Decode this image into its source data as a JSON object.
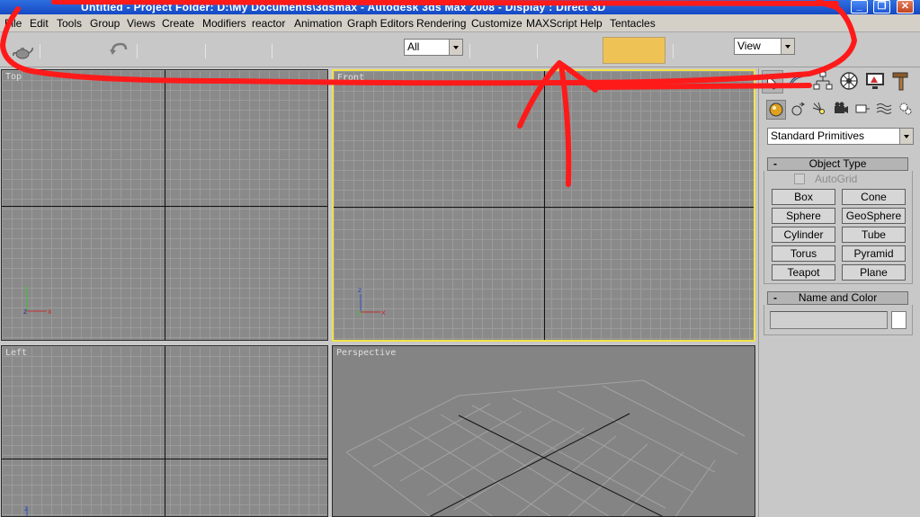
{
  "window": {
    "title": "Untitled   -   Project Folder: D:\\My Documents\\3dsmax   -   Autodesk 3ds Max 2008   -   Display : Direct 3D",
    "buttons": {
      "minimize_glyph": "_",
      "maximize_glyph": "❐",
      "close_glyph": "✕"
    }
  },
  "menubar": {
    "items": [
      "File",
      "Edit",
      "Tools",
      "Group",
      "Views",
      "Create",
      "Modifiers",
      "reactor",
      "Animation",
      "Graph Editors",
      "Rendering",
      "Customize",
      "MAXScript",
      "Help",
      "Tentacles"
    ]
  },
  "toolbar": {
    "selection_filter": "All",
    "reference_coord": "View",
    "icons": [
      "teapot-icon",
      "undo-icon"
    ],
    "swatch_color": "#eec255"
  },
  "annotation": {
    "color": "#ff1a1a"
  },
  "viewports": {
    "top": {
      "label": "Top"
    },
    "front": {
      "label": "Front"
    },
    "left": {
      "label": "Left"
    },
    "perspective": {
      "label": "Perspective"
    },
    "axis": {
      "x": "x",
      "y": "y",
      "z": "z"
    },
    "active_border_color": "#f2e24a"
  },
  "command_panel": {
    "tabs": [
      "create-tab",
      "modify-tab",
      "hierarchy-tab",
      "motion-tab",
      "display-tab",
      "utilities-tab"
    ],
    "subtabs": [
      "geometry",
      "shapes",
      "lights",
      "cameras",
      "helpers",
      "space-warps",
      "systems"
    ],
    "category_dropdown": "Standard Primitives",
    "object_type": {
      "title": "Object Type",
      "collapse": "-",
      "autogrid_label": "AutoGrid",
      "buttons": [
        "Box",
        "Cone",
        "Sphere",
        "GeoSphere",
        "Cylinder",
        "Tube",
        "Torus",
        "Pyramid",
        "Teapot",
        "Plane"
      ]
    },
    "name_and_color": {
      "title": "Name and Color",
      "collapse": "-",
      "name_value": "",
      "color": "#ffffff"
    }
  }
}
